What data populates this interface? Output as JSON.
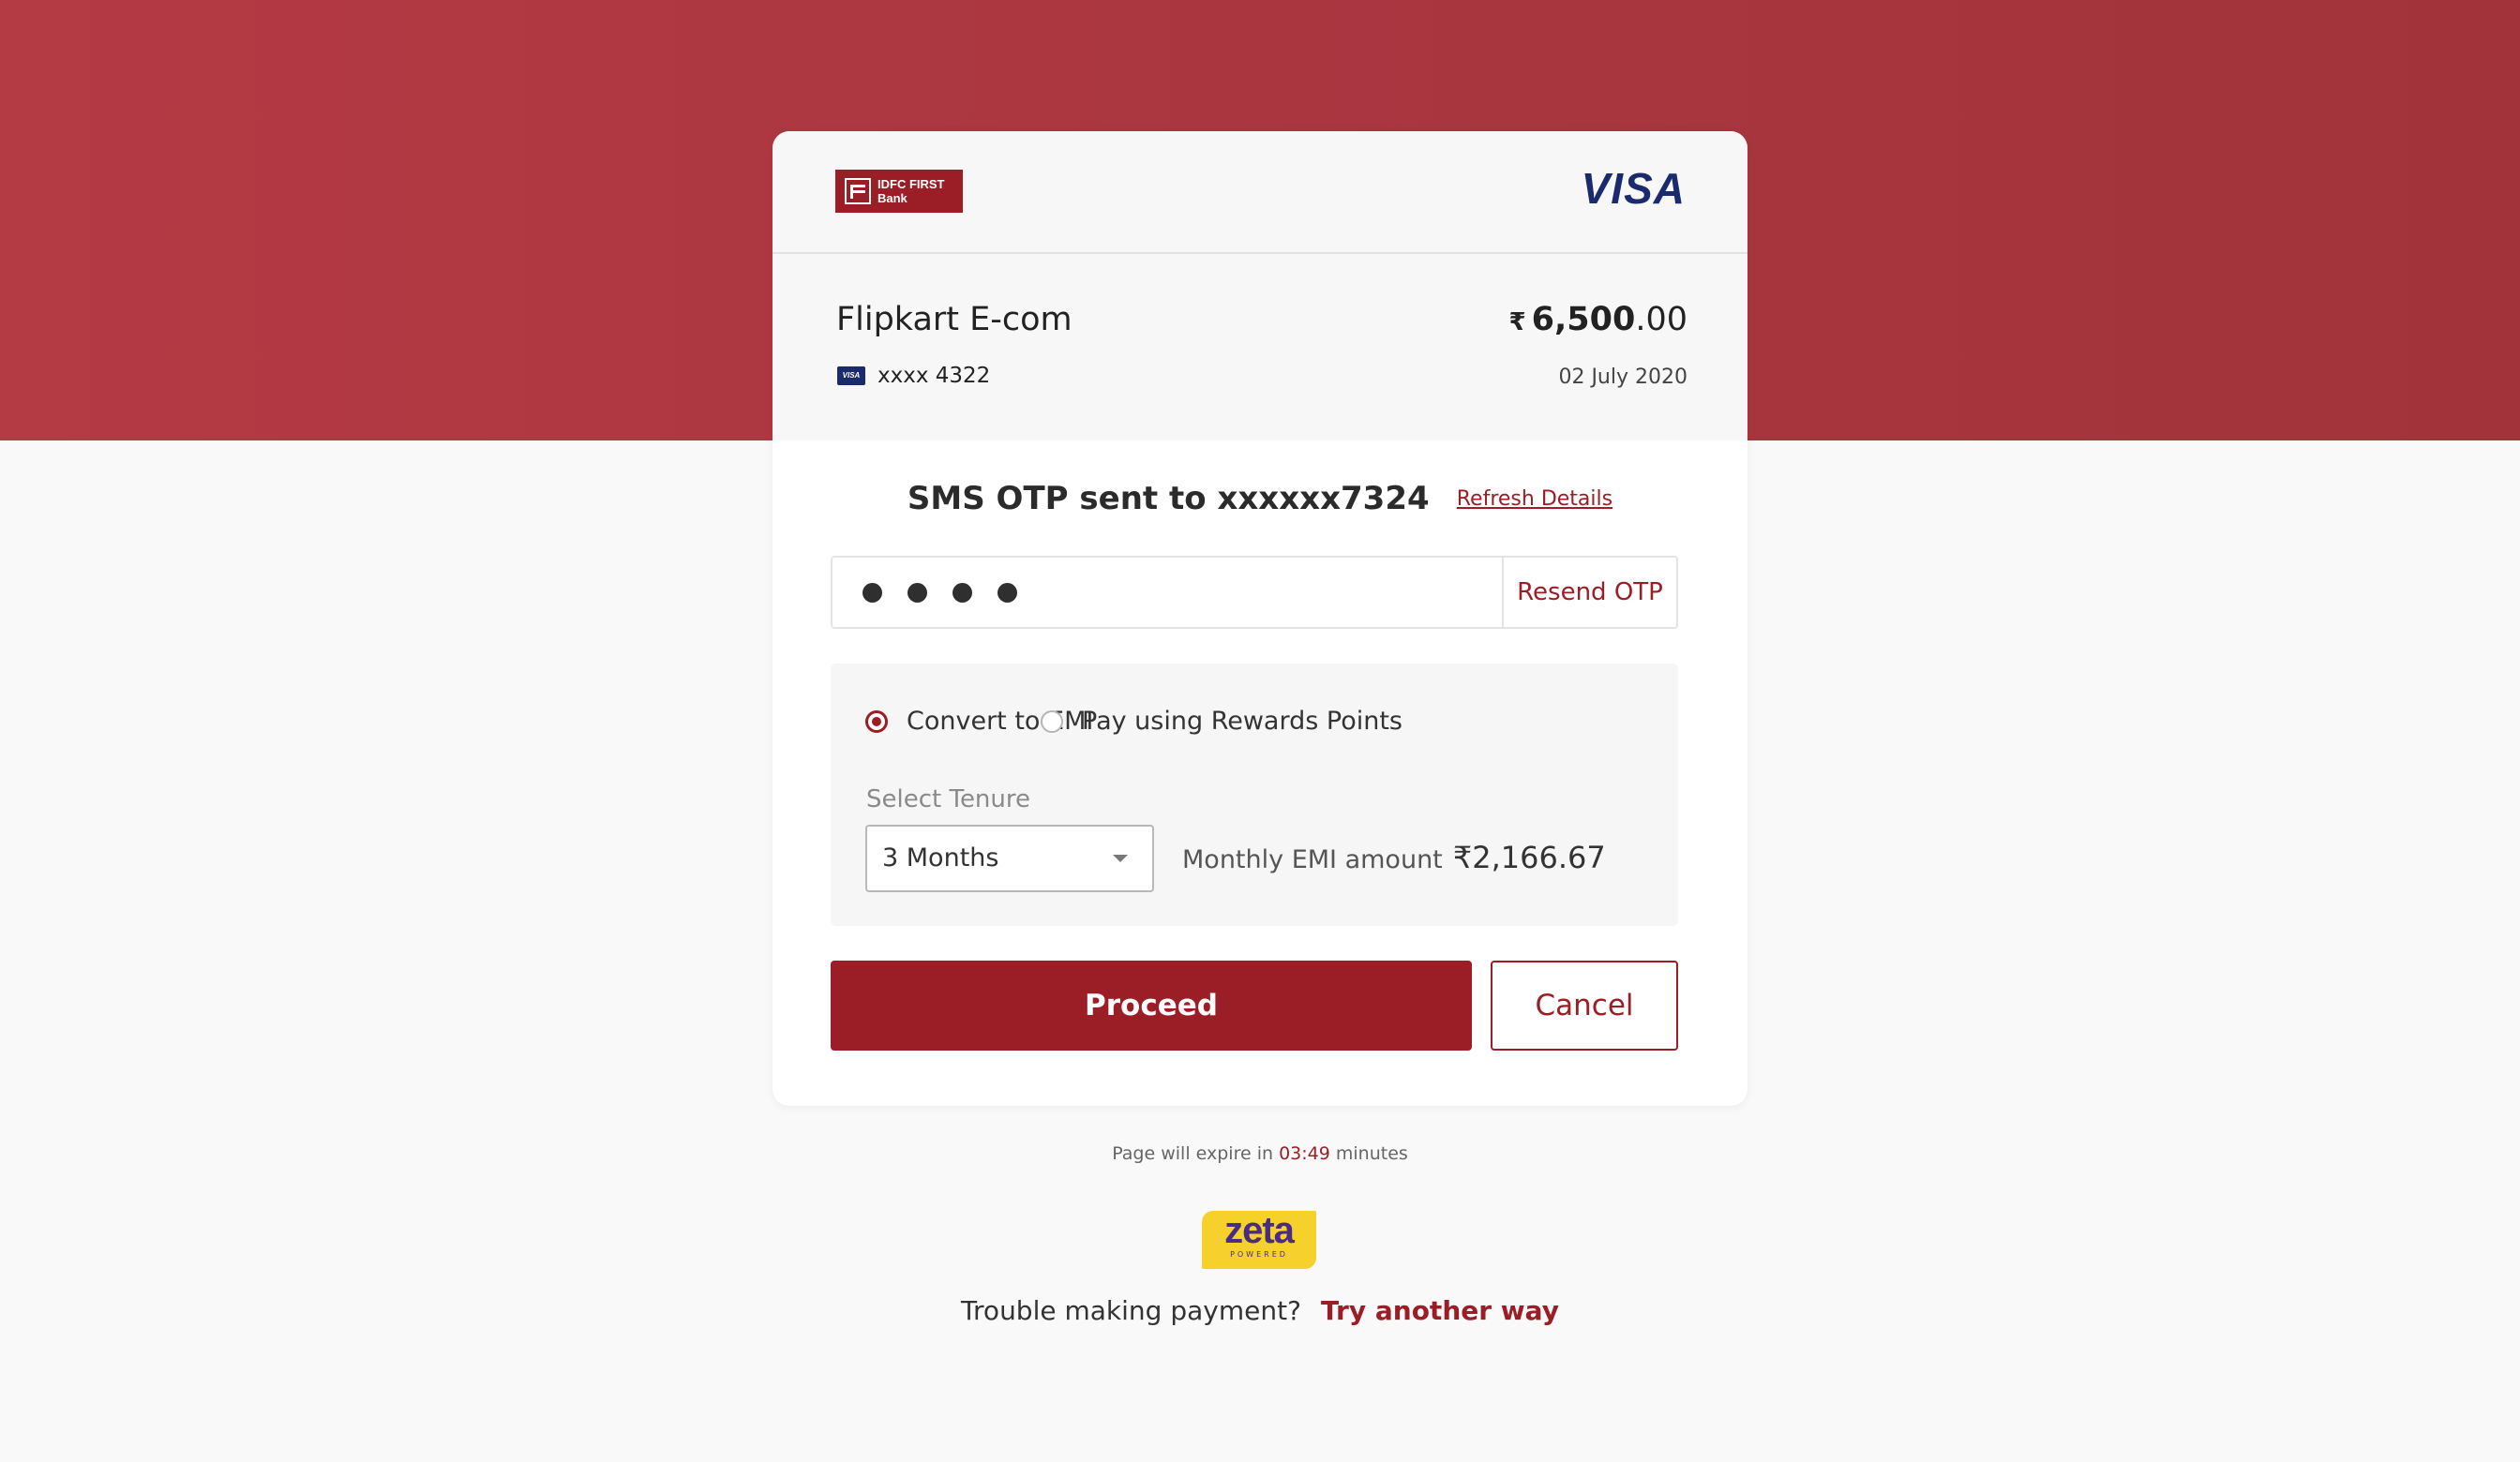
{
  "header": {
    "bank_logo_text_line1": "IDFC FIRST",
    "bank_logo_text_line2": "Bank",
    "network_logo": "VISA"
  },
  "transaction": {
    "merchant": "Flipkart E-com",
    "card_mini_label": "VISA",
    "card_number": "xxxx 4322",
    "currency_symbol": "₹",
    "amount_major": "6,500",
    "amount_minor": ".00",
    "date": "02 July 2020"
  },
  "otp": {
    "title": "SMS OTP sent to xxxxxx7324",
    "refresh_label": "Refresh Details",
    "entered_digits": 4,
    "resend_label": "Resend OTP"
  },
  "payment_options": {
    "options": [
      {
        "label": "Convert to EMI",
        "selected": true
      },
      {
        "label": "Pay using Rewards Points",
        "selected": false
      }
    ],
    "tenure_label": "Select Tenure",
    "tenure_value": "3 Months",
    "emi_amount_label": "Monthly EMI amount",
    "emi_amount_value": "₹2,166.67"
  },
  "actions": {
    "proceed_label": "Proceed",
    "cancel_label": "Cancel"
  },
  "footer": {
    "expire_prefix": "Page will expire in",
    "expire_time": "03:49",
    "expire_suffix": "minutes",
    "zeta_name": "zeta",
    "zeta_sub": "POWERED",
    "trouble_text": "Trouble making payment?",
    "try_another_label": "Try another way"
  },
  "colors": {
    "brand": "#9b1d25",
    "banner": "#b03a43",
    "visa_blue": "#1a2a6c",
    "zeta_yellow": "#f6d12b"
  }
}
